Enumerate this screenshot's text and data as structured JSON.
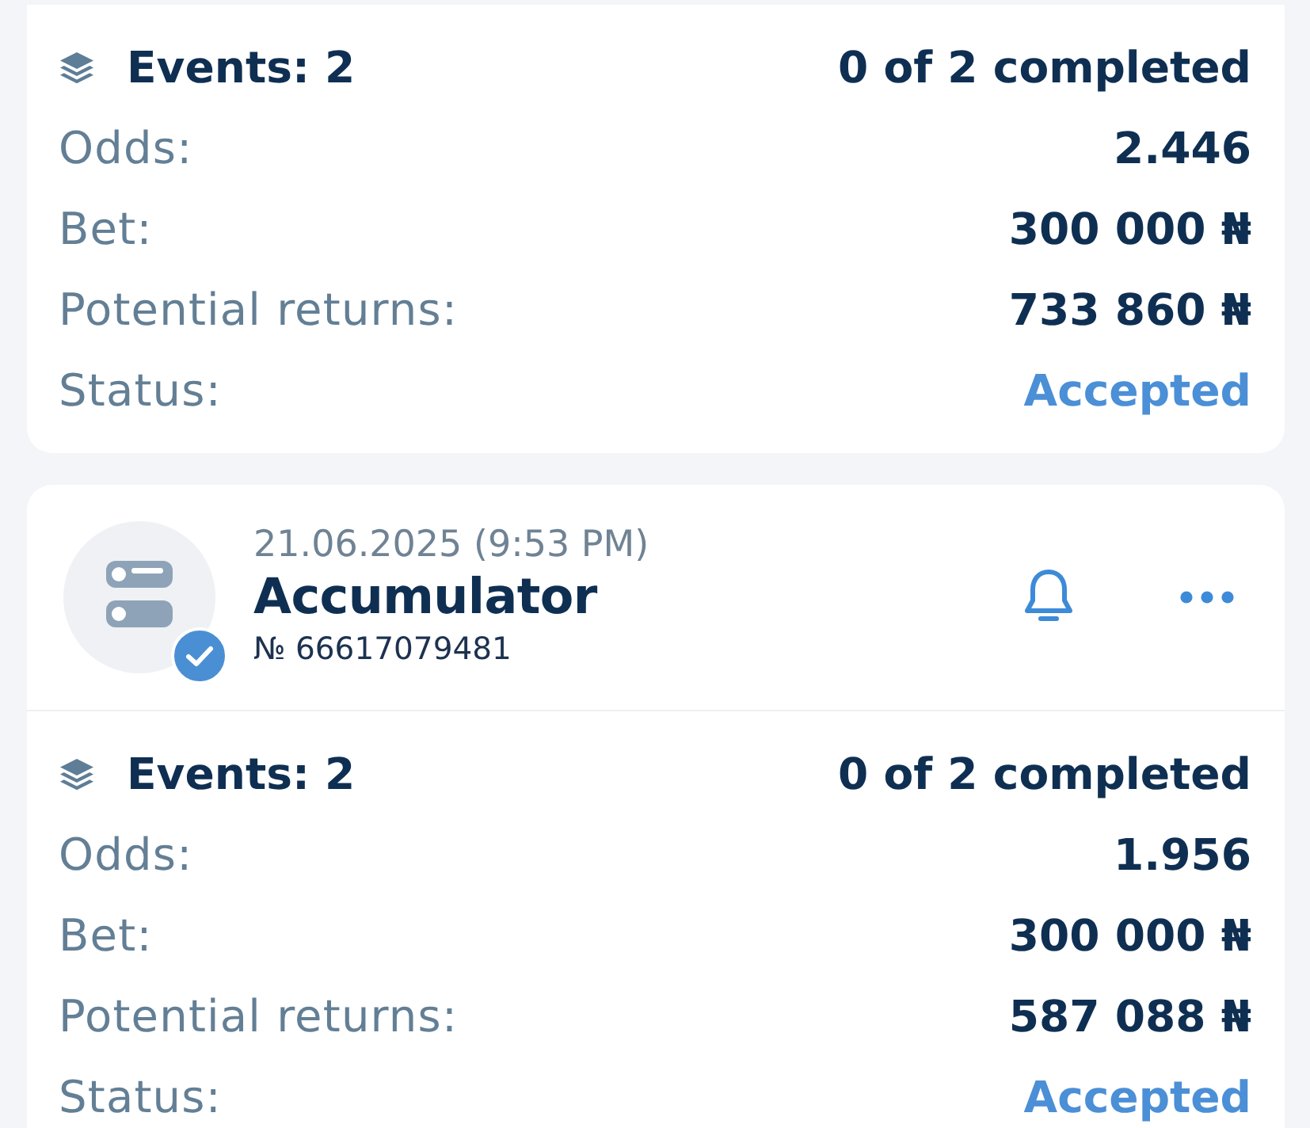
{
  "bets": [
    {
      "summary": {
        "events": "Events: 2",
        "completed": "0 of 2 completed"
      },
      "details": [
        {
          "label": "Odds:",
          "value": "2.446"
        },
        {
          "label": "Bet:",
          "value": "300 000 ₦"
        },
        {
          "label": "Potential returns:",
          "value": "733 860 ₦"
        }
      ],
      "status": {
        "label": "Status:",
        "value": "Accepted"
      }
    },
    {
      "header": {
        "date": "21.06.2025 (9:53 PM)",
        "type": "Accumulator",
        "number": "№ 66617079481",
        "verified": true
      },
      "summary": {
        "events": "Events: 2",
        "completed": "0 of 2 completed"
      },
      "details": [
        {
          "label": "Odds:",
          "value": "1.956"
        },
        {
          "label": "Bet:",
          "value": "300 000 ₦"
        },
        {
          "label": "Potential returns:",
          "value": "587 088 ₦"
        }
      ],
      "status": {
        "label": "Status:",
        "value": "Accepted"
      }
    }
  ]
}
